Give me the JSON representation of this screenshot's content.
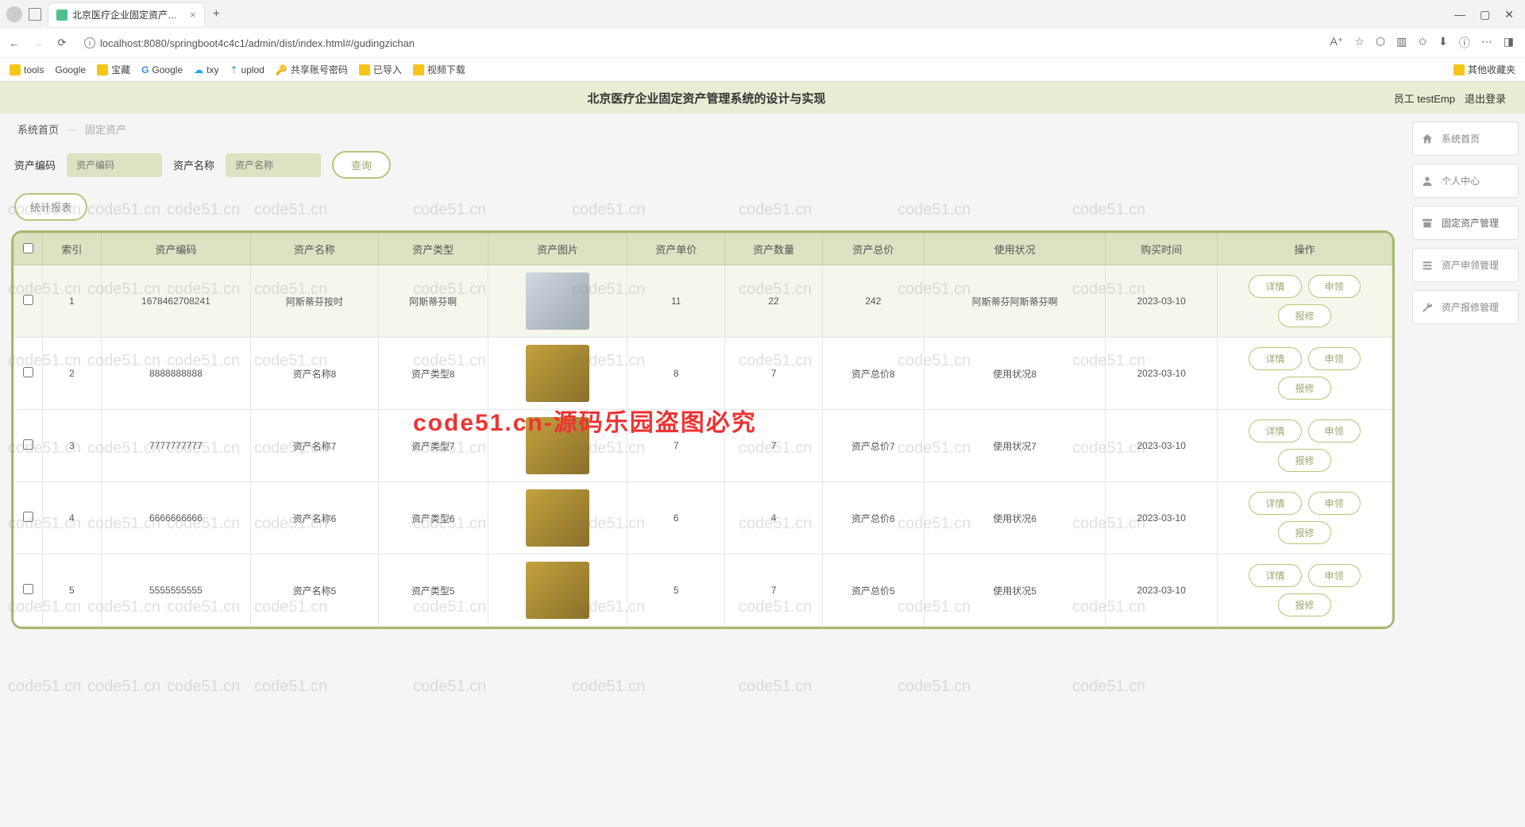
{
  "browser": {
    "tab_title": "北京医疗企业固定资产管理系统",
    "url": "localhost:8080/springboot4c4c1/admin/dist/index.html#/gudingzichan",
    "bookmarks": [
      "tools",
      "Google",
      "宝藏",
      "Google",
      "txy",
      "uplod",
      "共享账号密码",
      "已导入",
      "视频下载"
    ],
    "other_bookmarks": "其他收藏夹"
  },
  "header": {
    "title": "北京医疗企业固定资产管理系统的设计与实现",
    "user_label": "员工 testEmp",
    "logout": "退出登录"
  },
  "breadcrumb": {
    "home": "系统首页",
    "current": "固定资产"
  },
  "search": {
    "code_label": "资产编码",
    "code_placeholder": "资产编码",
    "name_label": "资产名称",
    "name_placeholder": "资产名称",
    "query": "查询",
    "stats": "统计报表"
  },
  "sidebar": [
    {
      "label": "系统首页"
    },
    {
      "label": "个人中心"
    },
    {
      "label": "固定资产管理"
    },
    {
      "label": "资产申领管理"
    },
    {
      "label": "资产报修管理"
    }
  ],
  "table": {
    "headers": [
      "索引",
      "资产编码",
      "资产名称",
      "资产类型",
      "资产图片",
      "资产单价",
      "资产数量",
      "资产总价",
      "使用状况",
      "购买时间",
      "操作"
    ],
    "op_labels": {
      "detail": "详情",
      "apply": "申领",
      "repair": "报修"
    },
    "rows": [
      {
        "idx": "1",
        "code": "1678462708241",
        "name": "阿斯蒂芬按时",
        "type": "阿斯蒂芬啊",
        "price": "11",
        "qty": "22",
        "total": "242",
        "status": "阿斯蒂芬阿斯蒂芬啊",
        "date": "2023-03-10",
        "img": "tech"
      },
      {
        "idx": "2",
        "code": "8888888888",
        "name": "资产名称8",
        "type": "资产类型8",
        "price": "8",
        "qty": "7",
        "total": "资产总价8",
        "status": "使用状况8",
        "date": "2023-03-10",
        "img": "gold"
      },
      {
        "idx": "3",
        "code": "7777777777",
        "name": "资产名称7",
        "type": "资产类型7",
        "price": "7",
        "qty": "7",
        "total": "资产总价7",
        "status": "使用状况7",
        "date": "2023-03-10",
        "img": "gold"
      },
      {
        "idx": "4",
        "code": "6666666666",
        "name": "资产名称6",
        "type": "资产类型6",
        "price": "6",
        "qty": "4",
        "total": "资产总价6",
        "status": "使用状况6",
        "date": "2023-03-10",
        "img": "gold"
      },
      {
        "idx": "5",
        "code": "5555555555",
        "name": "资产名称5",
        "type": "资产类型5",
        "price": "5",
        "qty": "7",
        "total": "资产总价5",
        "status": "使用状况5",
        "date": "2023-03-10",
        "img": "gold"
      }
    ]
  },
  "watermark": {
    "small": "code51.cn",
    "big": "code51.cn-源码乐园盗图必究"
  }
}
